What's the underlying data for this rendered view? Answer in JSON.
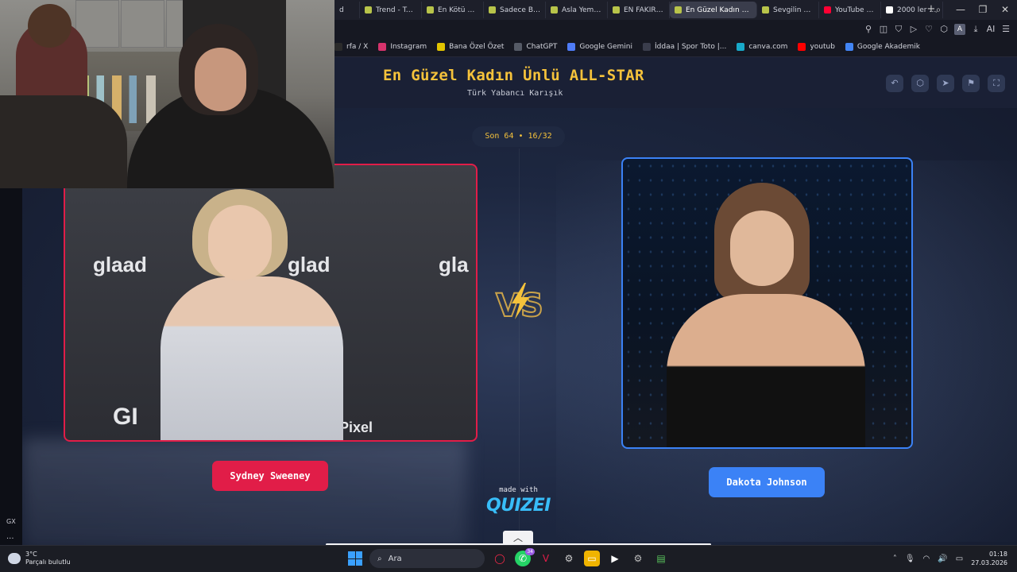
{
  "browser": {
    "tabs": [
      {
        "label": "d",
        "icon": "tab-icon"
      },
      {
        "label": "Trend - Turn",
        "icon": "quizei-icon"
      },
      {
        "label": "En Kötü Dat",
        "icon": "quizei-icon"
      },
      {
        "label": "Sadece Bir T",
        "icon": "quizei-icon"
      },
      {
        "label": "Asla Yemem",
        "icon": "quizei-icon"
      },
      {
        "label": "EN FAKİR Dı",
        "icon": "quizei-icon"
      },
      {
        "label": "En Güzel Kadın Ünlü A",
        "icon": "quizei-icon",
        "active": true
      },
      {
        "label": "Sevgilin sen",
        "icon": "quizei-icon"
      },
      {
        "label": "YouTube Mu",
        "icon": "youtube-music-icon"
      },
      {
        "label": "2000 ler ırrır",
        "icon": "google-icon"
      }
    ],
    "new_tab": "+",
    "toolbar_avatar": "A",
    "toolbar_ai": "AI",
    "bookmarks": [
      {
        "label": "rfa / X",
        "icon": "x-icon",
        "color": "#2b2b2b"
      },
      {
        "label": "Instagram",
        "icon": "instagram-icon",
        "color": "#d6336c"
      },
      {
        "label": "Bana Özel Özet",
        "icon": "s-icon",
        "color": "#e2c400"
      },
      {
        "label": "ChatGPT",
        "icon": "chatgpt-icon",
        "color": "#555a66"
      },
      {
        "label": "Google Gemini",
        "icon": "gemini-icon",
        "color": "#4f7cf7"
      },
      {
        "label": "İddaa | Spor Toto |...",
        "icon": "iddaa-icon",
        "color": "#3a3d4c"
      },
      {
        "label": "canva.com",
        "icon": "canva-icon",
        "color": "#18a9c9"
      },
      {
        "label": "youtub",
        "icon": "youtube-icon",
        "color": "#ff0000"
      },
      {
        "label": "Google Akademik",
        "icon": "scholar-icon",
        "color": "#4285f4"
      }
    ]
  },
  "quiz": {
    "title": "En Güzel Kadın Ünlü ALL-STAR",
    "subtitle": "Türk Yabancı Karışık",
    "round": "Son 64 • 16/32",
    "left_name": "Sydney Sweeney",
    "right_name": "Dakota Johnson",
    "made_with": "made with",
    "brand": "QUIZEI",
    "left_photo_text_1": "glaad",
    "left_photo_text_2": "glad",
    "left_photo_text_3": "gla",
    "left_photo_text_4": "GI",
    "left_photo_text_5": "Pixel",
    "colors": {
      "accent_gold": "#f5c23b",
      "left": "#e11d48",
      "right": "#3b82f6",
      "brand": "#38bdf8"
    }
  },
  "side": {
    "gx": "GX",
    "more": "..."
  },
  "taskbar": {
    "temp": "3°C",
    "weather": "Parçalı bulutlu",
    "search": "Ara",
    "badge": "34",
    "time": "01:18",
    "date": "27.03.2026"
  }
}
